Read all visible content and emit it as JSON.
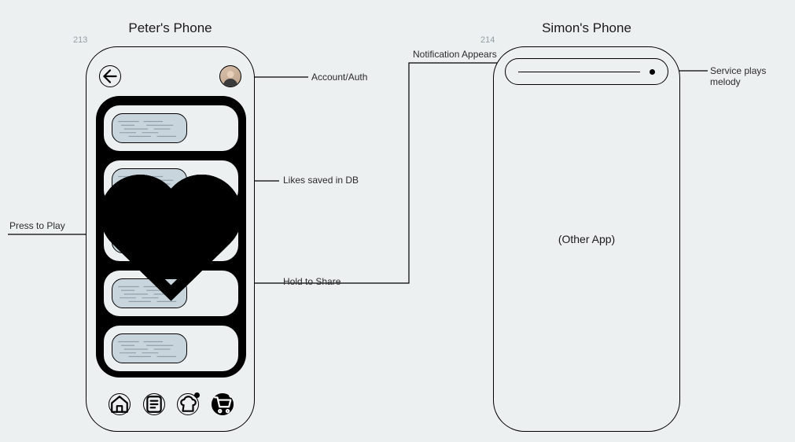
{
  "titles": {
    "peter": "Peter's Phone",
    "simon": "Simon's Phone"
  },
  "frame_labels": {
    "peter": "213",
    "simon": "214"
  },
  "annotations": {
    "account": "Account/Auth",
    "likes": "Likes saved in DB",
    "play": "Press to Play",
    "share": "Hold to Share",
    "notify": "Notification Appears",
    "melody": "Service plays melody"
  },
  "simon_body": "(Other App)",
  "cards": [
    {
      "liked": false
    },
    {
      "liked": true
    },
    {
      "liked": true
    },
    {
      "liked": false
    },
    {
      "liked": false
    }
  ],
  "tabs": [
    {
      "name": "home-icon",
      "badge": false,
      "active": false
    },
    {
      "name": "list-icon",
      "badge": false,
      "active": false
    },
    {
      "name": "chef-icon",
      "badge": true,
      "active": false
    },
    {
      "name": "cart-icon",
      "badge": true,
      "active": true
    }
  ]
}
